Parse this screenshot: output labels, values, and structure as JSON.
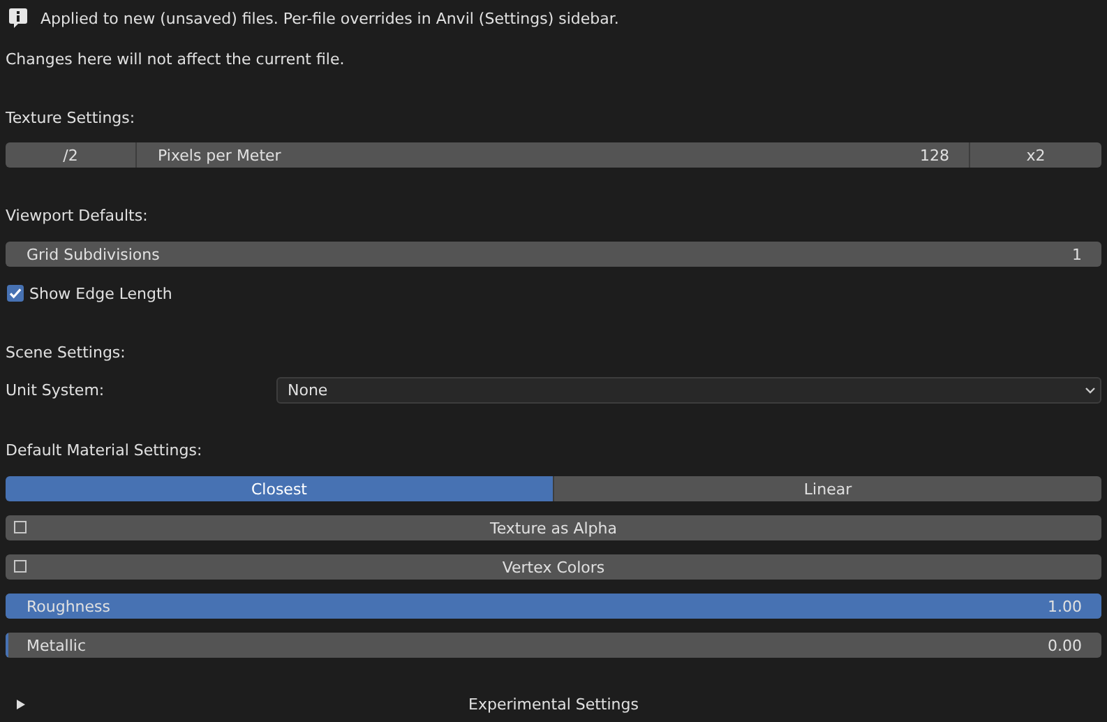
{
  "info": {
    "text": "Applied to new (unsaved) files. Per-file overrides in Anvil (Settings) sidebar.",
    "note": "Changes here will not affect the current file."
  },
  "texture": {
    "heading": "Texture Settings:",
    "decrease": "/2",
    "label": "Pixels per Meter",
    "value": "128",
    "increase": "x2"
  },
  "viewport": {
    "heading": "Viewport Defaults:",
    "grid": {
      "label": "Grid Subdivisions",
      "value": "1"
    },
    "edge_length": {
      "label": "Show Edge Length",
      "checked": true
    }
  },
  "scene": {
    "heading": "Scene Settings:",
    "unit_label": "Unit System:",
    "unit_value": "None"
  },
  "material": {
    "heading": "Default Material Settings:",
    "interpolation": [
      {
        "label": "Closest",
        "selected": true
      },
      {
        "label": "Linear",
        "selected": false
      }
    ],
    "toggles": [
      {
        "label": "Texture as Alpha",
        "checked": false
      },
      {
        "label": "Vertex Colors",
        "checked": false
      }
    ],
    "sliders": [
      {
        "label": "Roughness",
        "value": "1.00",
        "level": 1
      },
      {
        "label": "Metallic",
        "value": "0.00",
        "level": 0
      }
    ]
  },
  "experimental": {
    "label": "Experimental Settings",
    "expanded": false
  }
}
